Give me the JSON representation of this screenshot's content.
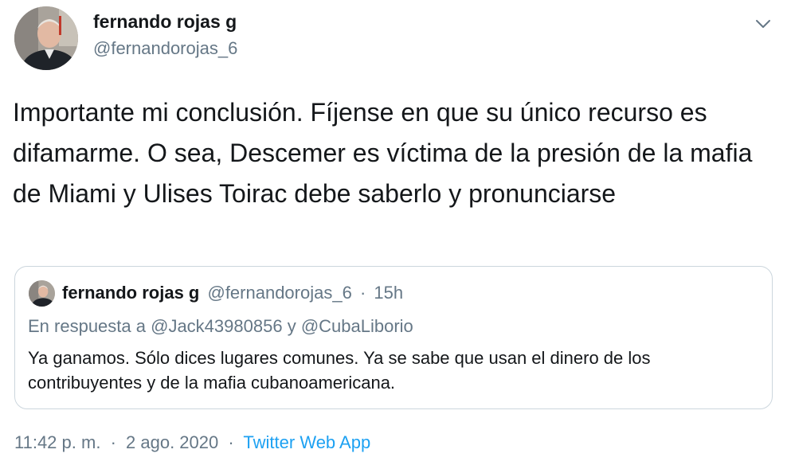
{
  "tweet": {
    "author": {
      "display_name": "fernando rojas g",
      "handle": "@fernandorojas_6",
      "avatar_icon": "profile-photo"
    },
    "menu_icon": "chevron-down-icon",
    "text": "Importante mi conclusión. Fíjense en que su único recurso es difamarme. O sea, Descemer es víctima de la presión de la mafia de Miami y Ulises Toirac debe saberlo y pronunciarse",
    "quoted": {
      "display_name": "fernando rojas g",
      "handle": "@fernandorojas_6",
      "separator": "·",
      "time": "15h",
      "reply_prefix": "En respuesta a",
      "reply_mention_1": "@Jack43980856",
      "reply_conjunction": "y",
      "reply_mention_2": "@CubaLiborio",
      "text": "Ya ganamos. Sólo dices lugares comunes. Ya se sabe que usan el dinero de los contribuyentes y de la mafia cubanoamericana."
    },
    "footer": {
      "time": "11:42 p. m.",
      "separator": "·",
      "date": "2 ago. 2020",
      "source": "Twitter Web App"
    }
  },
  "colors": {
    "text": "#14171a",
    "secondary": "#657786",
    "link": "#1da1f2",
    "border": "#ccd6dd"
  }
}
